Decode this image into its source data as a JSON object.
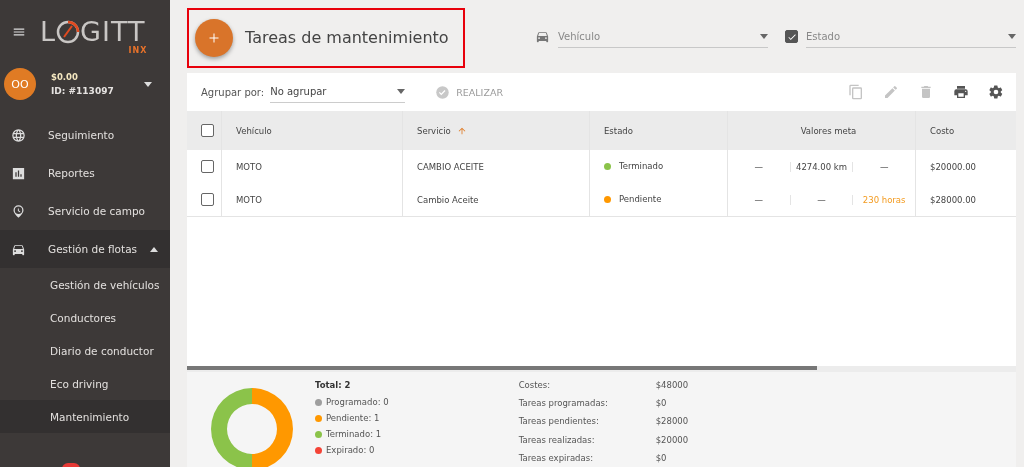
{
  "sidebar": {
    "logo": {
      "before": "L",
      "after": "GITT",
      "sub": "INX"
    },
    "account": {
      "initials": "OO",
      "balance": "$0.00",
      "id": "ID: #113097"
    },
    "items": [
      {
        "label": "Seguimiento",
        "expanded": false,
        "selected": false
      },
      {
        "label": "Reportes",
        "expanded": false,
        "selected": false
      },
      {
        "label": "Servicio de campo",
        "expanded": false,
        "selected": false
      },
      {
        "label": "Gestión de flotas",
        "expanded": true,
        "selected": false,
        "children": [
          {
            "label": "Gestión de vehículos",
            "selected": false
          },
          {
            "label": "Conductores",
            "selected": false
          },
          {
            "label": "Diario de conductor",
            "selected": false
          },
          {
            "label": "Eco driving",
            "selected": false
          },
          {
            "label": "Mantenimiento",
            "selected": true
          }
        ]
      }
    ]
  },
  "header": {
    "title": "Tareas de mantenimiento",
    "highlighted": true,
    "filters": [
      {
        "kind": "car",
        "placeholder": "Vehículo"
      },
      {
        "kind": "check",
        "placeholder": "Estado",
        "checked": true
      }
    ]
  },
  "toolbar": {
    "group_label": "Agrupar por:",
    "group_value": "No agrupar",
    "action": {
      "label": "REALIZAR",
      "disabled": true
    },
    "icons": [
      {
        "kind": "copy",
        "disabled": true
      },
      {
        "kind": "edit",
        "disabled": true
      },
      {
        "kind": "delete",
        "disabled": true
      },
      {
        "kind": "print",
        "disabled": false
      },
      {
        "kind": "settings",
        "disabled": false
      }
    ]
  },
  "table": {
    "select_all_checked": false,
    "columns": [
      {
        "label": "Vehículo",
        "sorted": false
      },
      {
        "label": "Servicio",
        "sorted": true
      },
      {
        "label": "Estado",
        "sorted": false
      },
      {
        "label": "Valores meta",
        "sorted": false
      },
      {
        "label": "Costo",
        "sorted": false
      }
    ],
    "rows": [
      {
        "checked": false,
        "vehicle": "MOTO",
        "service": "CAMBIO ACEITE",
        "status": "Terminado",
        "color": "#8bc34a",
        "meta": [
          {
            "text": "—",
            "warning": false
          },
          {
            "text": "4274.00 km",
            "warning": false
          },
          {
            "text": "—",
            "warning": false
          }
        ],
        "cost": "$20000.00"
      },
      {
        "checked": false,
        "vehicle": "MOTO",
        "service": "Cambio Aceite",
        "status": "Pendiente",
        "color": "#ff9800",
        "meta": [
          {
            "text": "—",
            "warning": false
          },
          {
            "text": "—",
            "warning": false
          },
          {
            "text": "230 horas",
            "warning": true
          }
        ],
        "cost": "$28000.00"
      }
    ]
  },
  "summary": {
    "chart_data": {
      "type": "donut",
      "categories": [
        "Programado: 0",
        "Pendiente: 1",
        "Terminado: 1",
        "Expirado: 0"
      ],
      "series": [
        {
          "values": [
            0,
            1,
            1,
            0
          ]
        }
      ],
      "colors": [
        "#9e9e9e",
        "#ff9800",
        "#8bc34a",
        "#f44336"
      ]
    },
    "total": "Total: 2",
    "costs": [
      {
        "label": "Costes:",
        "value": "$48000"
      },
      {
        "label": "Tareas programadas:",
        "value": "$0"
      },
      {
        "label": "Tareas pendientes:",
        "value": "$28000"
      },
      {
        "label": "Tareas realizadas:",
        "value": "$20000"
      },
      {
        "label": "Tareas expiradas:",
        "value": "$0"
      }
    ]
  }
}
